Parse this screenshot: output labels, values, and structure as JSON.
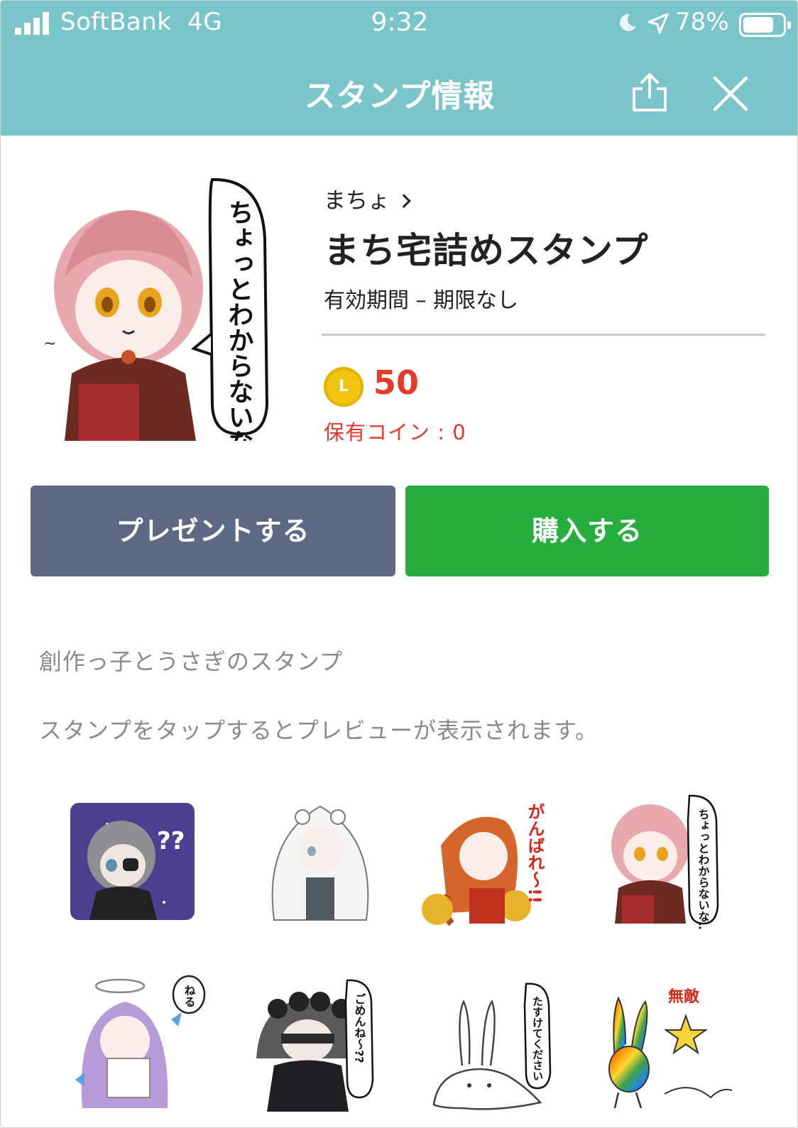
{
  "status_bar": {
    "carrier": "SoftBank",
    "network": "4G",
    "time": "9:32",
    "battery": "78%",
    "battery_level": 0.78,
    "icons": [
      "signal-bars-icon",
      "moon-icon",
      "location-arrow-icon",
      "battery-icon"
    ]
  },
  "header": {
    "title": "スタンプ情報",
    "bg_color": "#79c5c9",
    "icons": [
      "share-icon",
      "close-icon"
    ]
  },
  "sticker_pack": {
    "author": "まちょ",
    "name": "まち宅詰めスタンプ",
    "validity": "有効期間 – 期限なし",
    "coin_symbol": "L",
    "price": "50",
    "owned_coins": "保有コイン : 0",
    "price_color": "#e33a2c"
  },
  "actions": {
    "gift_label": "プレゼントする",
    "buy_label": "購入する",
    "gift_color": "#5d6882",
    "buy_color": "#25ad3d"
  },
  "description": "創作っ子とうさぎのスタンプ",
  "preview_hint": "スタンプをタップするとプレビューが表示されます。",
  "stickers": [
    {
      "name": "sticker-grey-hair-eyepatch-question"
    },
    {
      "name": "sticker-white-veil-girl"
    },
    {
      "name": "sticker-orange-cheer-girl",
      "text": "がんばれ〜!!"
    },
    {
      "name": "sticker-pink-hair-book",
      "text": "ちょっとわからないな…"
    },
    {
      "name": "sticker-purple-angel",
      "text": "ねる"
    },
    {
      "name": "sticker-black-rose-girl",
      "text": "ごめんね〜??"
    },
    {
      "name": "sticker-melting-rabbit",
      "text": "たすけてください"
    },
    {
      "name": "sticker-rainbow-rabbit-star",
      "text": "無敵"
    }
  ],
  "hero_bubble_text": "ちょっとわからないな…"
}
